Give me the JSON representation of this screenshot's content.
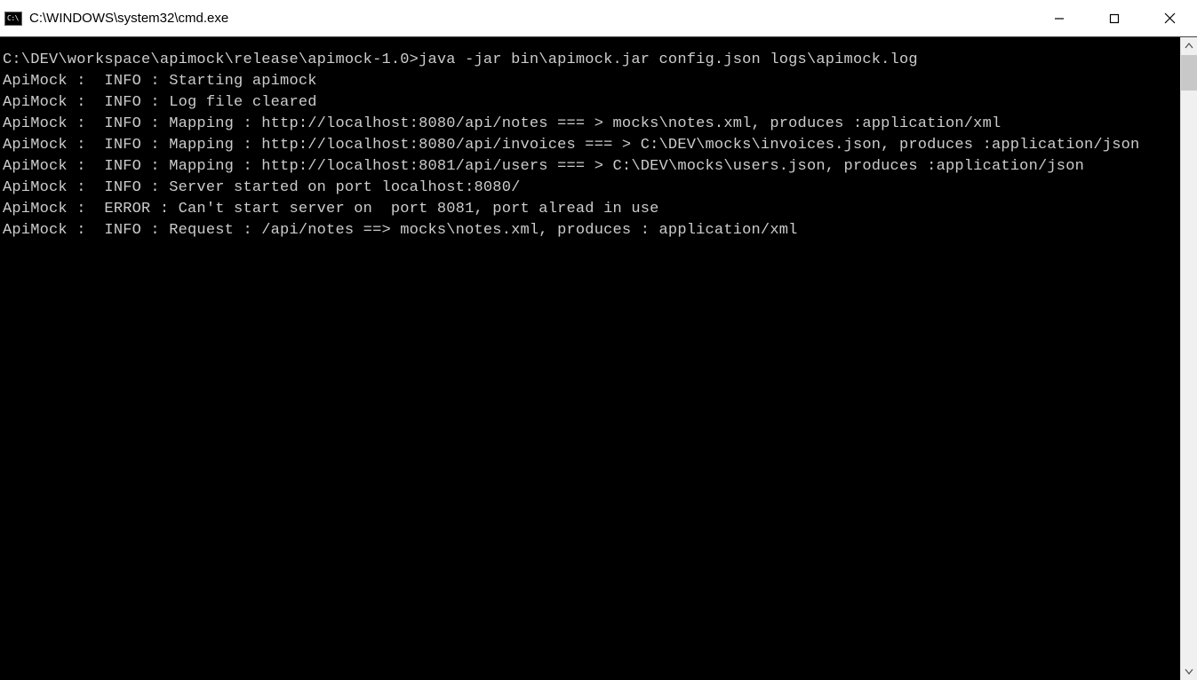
{
  "window": {
    "icon_text": "C:\\",
    "title": "C:\\WINDOWS\\system32\\cmd.exe"
  },
  "terminal": {
    "prompt": "C:\\DEV\\workspace\\apimock\\release\\apimock-1.0>",
    "command": "java -jar bin\\apimock.jar config.json logs\\apimock.log",
    "lines": [
      "ApiMock :  INFO : Starting apimock",
      "ApiMock :  INFO : Log file cleared",
      "ApiMock :  INFO : Mapping : http://localhost:8080/api/notes === > mocks\\notes.xml, produces :application/xml",
      "ApiMock :  INFO : Mapping : http://localhost:8080/api/invoices === > C:\\DEV\\mocks\\invoices.json, produces :application/json",
      "ApiMock :  INFO : Mapping : http://localhost:8081/api/users === > C:\\DEV\\mocks\\users.json, produces :application/json",
      "ApiMock :  INFO : Server started on port localhost:8080/",
      "ApiMock :  ERROR : Can't start server on  port 8081, port alread in use",
      "ApiMock :  INFO : Request : /api/notes ==> mocks\\notes.xml, produces : application/xml"
    ]
  }
}
